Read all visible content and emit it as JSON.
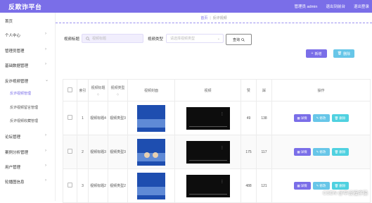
{
  "app": {
    "title": "反欺诈平台"
  },
  "header": {
    "admin_label": "管理员 admin",
    "front_label": "退出到前台",
    "logout_label": "退出登录"
  },
  "sidebar": {
    "items": [
      {
        "label": "首页"
      },
      {
        "label": "个人中心"
      },
      {
        "label": "管理员管理"
      },
      {
        "label": "基础数据管理"
      },
      {
        "label": "反诈视频管理"
      },
      {
        "label": "论坛管理"
      },
      {
        "label": "案例分析管理"
      },
      {
        "label": "用户管理"
      },
      {
        "label": "轮播图信息"
      }
    ],
    "subitems": [
      {
        "label": "反诈视频管理"
      },
      {
        "label": "反诈视频留言管理"
      },
      {
        "label": "反诈视频收藏管理"
      }
    ]
  },
  "breadcrumb": {
    "home": "首页",
    "current": "反诈视频"
  },
  "search": {
    "title_label": "视频标题",
    "title_placeholder": "视频标题",
    "type_label": "视频类型",
    "type_placeholder": "请选择视频类型",
    "query_label": "查询"
  },
  "toolbar": {
    "add_label": "新增",
    "delete_label": "删除"
  },
  "table": {
    "headers": {
      "index": "索引",
      "title": "视频标题",
      "type": "视频类型",
      "cover": "视频封面",
      "video": "视频",
      "likes": "赞",
      "dislikes": "踩",
      "ops": "操作"
    },
    "sort_glyph": "◇",
    "rows": [
      {
        "index": "1",
        "title": "视频标题4",
        "type": "视频类型3",
        "likes": "49",
        "dislikes": "138"
      },
      {
        "index": "2",
        "title": "视频标题3",
        "type": "视频类型3",
        "likes": "175",
        "dislikes": "117"
      },
      {
        "index": "3",
        "title": "视频标题2",
        "type": "视频类型2",
        "likes": "488",
        "dislikes": "121"
      }
    ],
    "ops": {
      "detail": "详情",
      "edit": "修改",
      "remove": "删除"
    }
  },
  "watermark": "CSDN @毕设程序猿"
}
